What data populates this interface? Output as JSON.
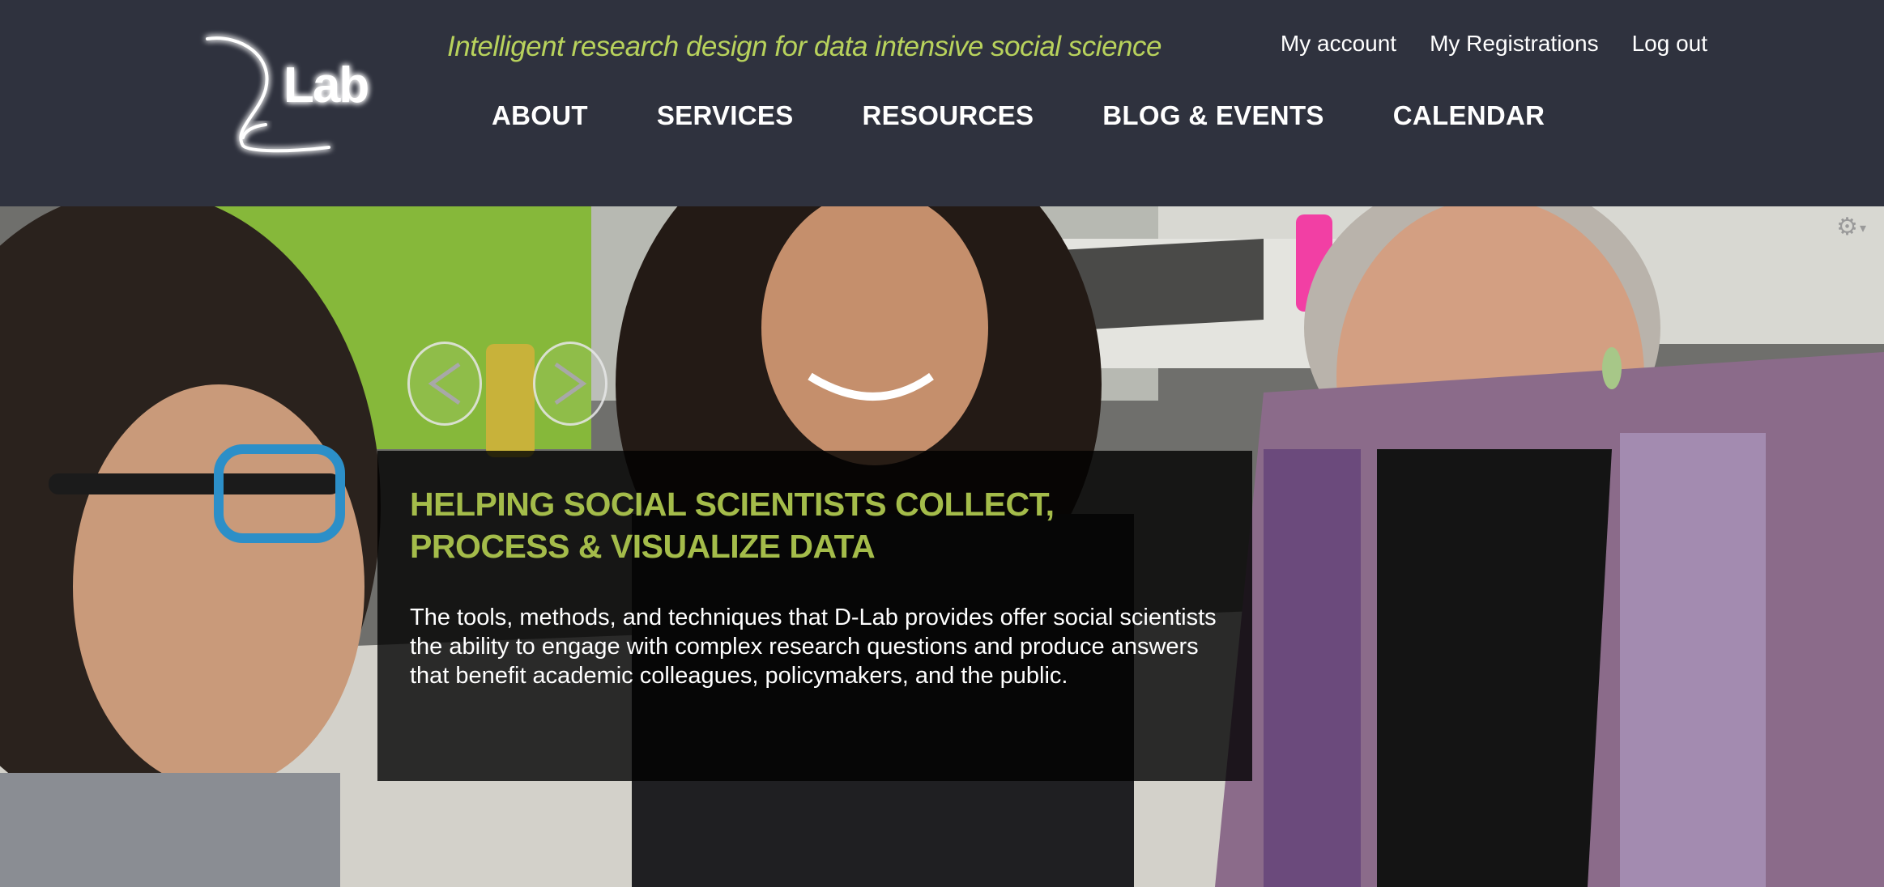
{
  "header": {
    "logo_text": "Lab",
    "tagline": "Intelligent research design for data intensive social science",
    "user_menu": {
      "my_account": "My account",
      "my_registrations": "My Registrations",
      "log_out": "Log out"
    },
    "nav": {
      "about": "ABOUT",
      "services": "SERVICES",
      "resources": "RESOURCES",
      "blog_events": "BLOG & EVENTS",
      "calendar": "CALENDAR"
    }
  },
  "hero": {
    "title": "HELPING SOCIAL SCIENTISTS COLLECT, PROCESS & VISUALIZE DATA",
    "body": "The tools, methods, and techniques that D-Lab provides offer social scientists the ability to engage with complex research questions and produce answers that benefit academic colleagues, policymakers, and the public.",
    "prev_glyph": "<",
    "next_glyph": ">",
    "gear_icon": "gear-icon"
  },
  "colors": {
    "header_bg": "#2f323e",
    "tagline": "#b8d25c",
    "caption_title": "#a4bc4a",
    "caption_bg": "rgba(0,0,0,0.8)",
    "nav_text": "#ffffff"
  }
}
